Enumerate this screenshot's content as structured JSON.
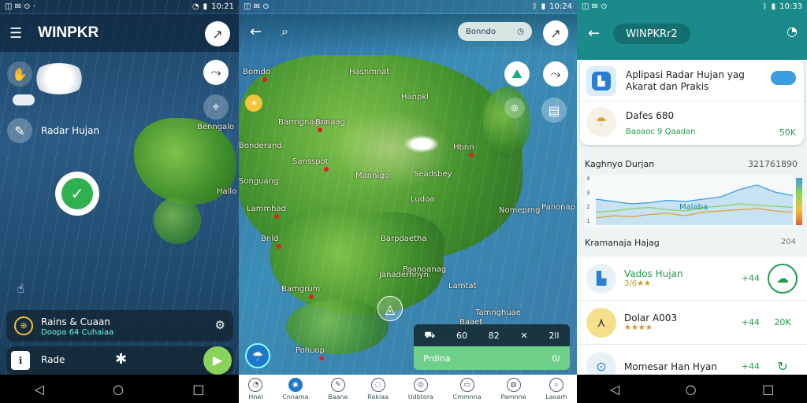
{
  "status_left": {
    "time": "10:21"
  },
  "status_mid": {
    "time": "10:24"
  },
  "status_right": {
    "time": "10:33"
  },
  "left": {
    "app_title": "WINPKR",
    "radar_label": "Radar Hujan",
    "map_label": "Benngalo",
    "map_label2": "Hallo",
    "card_title": "Rains & Cuaan",
    "card_sub": "Doopa 64 Cuhaiaa",
    "bottom_label": "Rade"
  },
  "middle": {
    "search_pill": "Bonndo",
    "cities": [
      "Bomdo",
      "Hasnmnat",
      "Hanpkl",
      "Barmgnagan",
      "Bonaag",
      "Bonderand",
      "Sansspot",
      "Songuang",
      "Seadsbey",
      "Hbnn",
      "Mannigo",
      "Ludoa",
      "Lammhad",
      "Nomeprng",
      "Barpdaetha",
      "Bnld",
      "Janaderhnyn",
      "Lamtat",
      "Bamgrum",
      "Paanoanag",
      "Baaet",
      "Pohuop",
      "Tamnghuae",
      "Panonap"
    ],
    "chips": [
      "60",
      "82",
      "2ll"
    ],
    "green_bar": "Prdina",
    "green_bar_right": "0/"
  },
  "bottom_nav": [
    "Hnel",
    "Cnnama",
    "Baane",
    "Rakiaa",
    "Udbtora",
    "Cmmnna",
    "Pamnne",
    "Laoarh"
  ],
  "right": {
    "title": "WINPKRr2",
    "card1_title": "Aplipasi Radar Hujan yag Akarat dan Prakis",
    "card2_title": "Dafes 680",
    "card2_sub": "Baoaoc 9 Qaadan",
    "card2_value": "50K",
    "chart_title": "Kaghnyo Durjan",
    "chart_code": "321761890",
    "chart_marker": "Malaba",
    "section_title": "Kramanaja Hajag",
    "section_meta": "204",
    "list": [
      {
        "name": "Vados Hujan",
        "sub": "3/6★★",
        "value": "+44"
      },
      {
        "name": "Dolar A003",
        "sub": "★★★★",
        "value": "+44",
        "extra": "20K"
      },
      {
        "name": "Momesar Han Hyan",
        "sub": "",
        "value": "+44"
      }
    ]
  },
  "chart_data": {
    "type": "line",
    "title": "Kaghnyo Durjan",
    "xlabel": "",
    "ylabel": "",
    "ylim": [
      0,
      4
    ],
    "yticks": [
      "4",
      "3",
      "2",
      "1"
    ],
    "series": [
      {
        "values": [
          2.2,
          2.0,
          1.8,
          1.9,
          2.1,
          2.0,
          2.2,
          2.4,
          3.0,
          3.4,
          2.8,
          2.5
        ]
      },
      {
        "values": [
          1.1,
          1.2,
          1.4,
          1.5,
          1.3,
          1.2,
          1.5,
          1.6,
          1.8,
          1.7,
          1.6,
          1.5
        ]
      },
      {
        "values": [
          0.6,
          0.8,
          0.7,
          0.9,
          1.0,
          0.8,
          1.1,
          1.2,
          1.3,
          1.4,
          1.2,
          1.1
        ]
      }
    ]
  }
}
